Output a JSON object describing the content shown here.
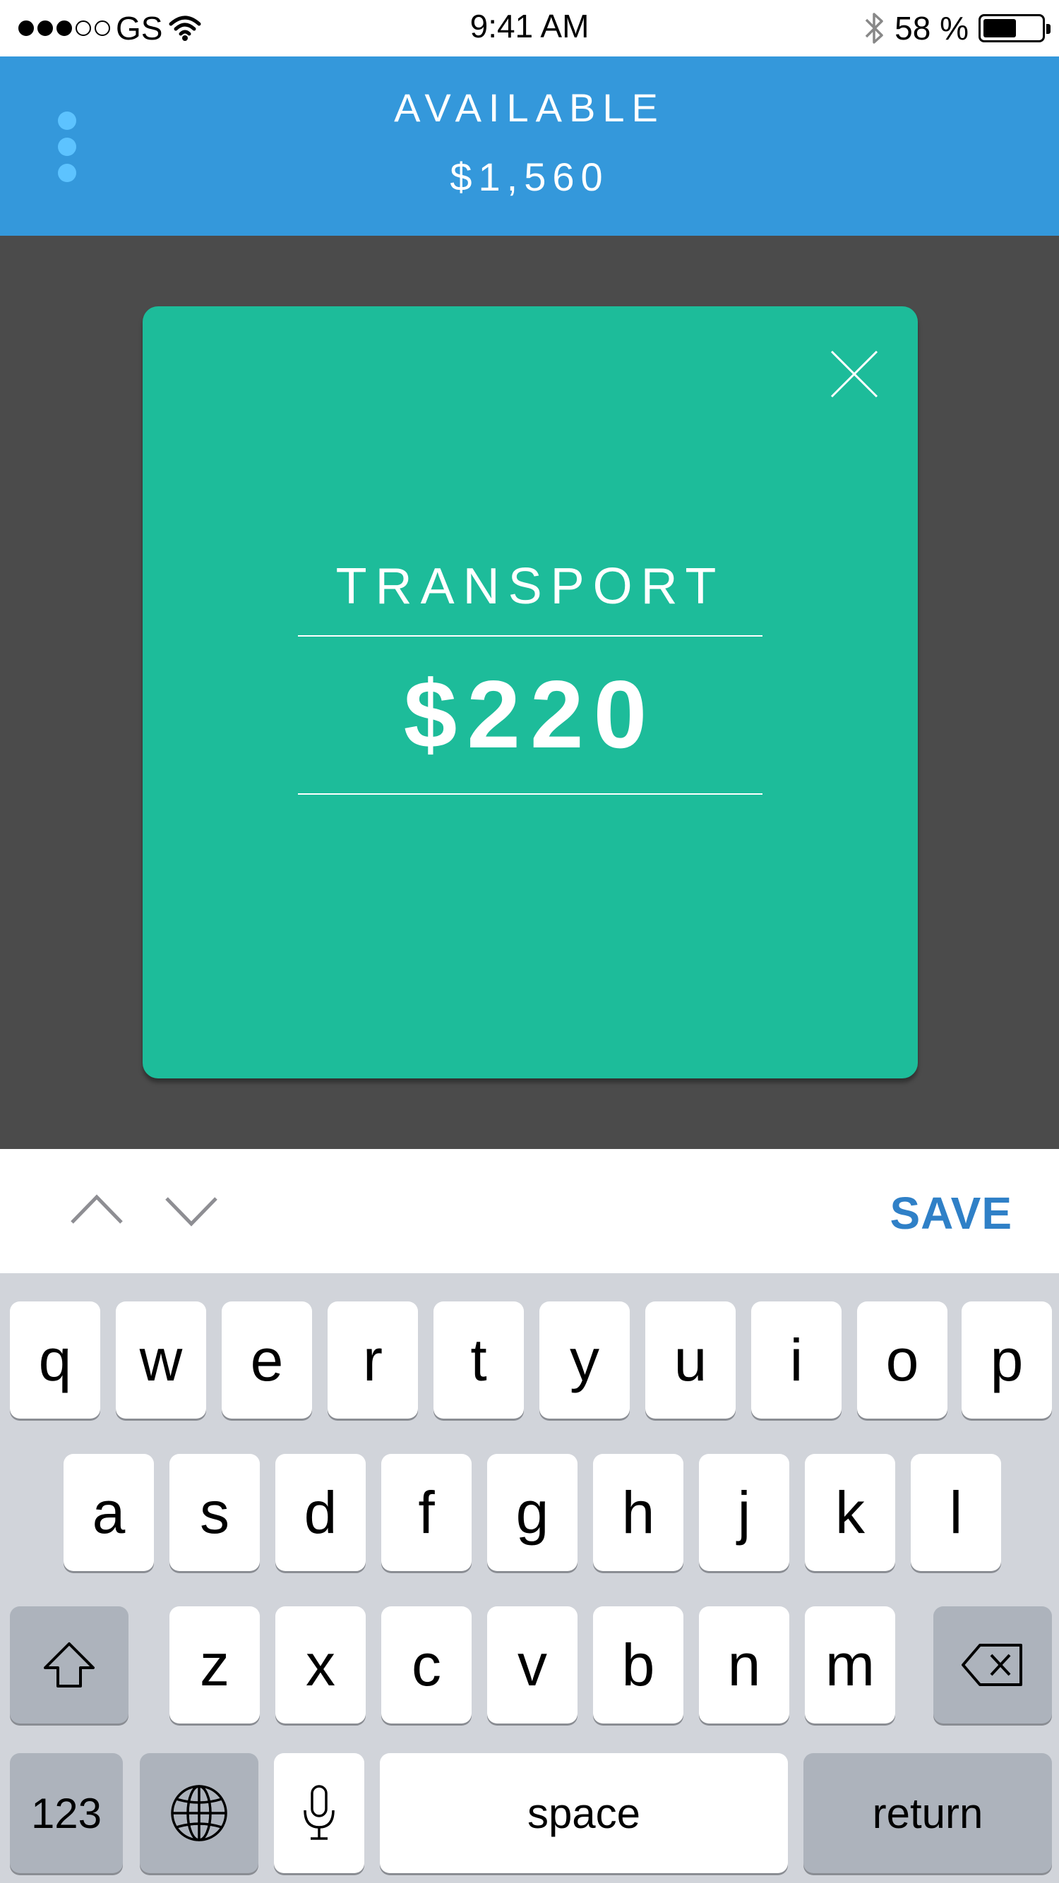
{
  "status_bar": {
    "carrier": "GS",
    "time": "9:41 AM",
    "battery": "58 %",
    "battery_level": 0.58,
    "signal_bars_filled": 3,
    "signal_bars_total": 5
  },
  "header": {
    "label": "AVAILABLE",
    "amount": "$1,560"
  },
  "card": {
    "title": "TRANSPORT",
    "amount": "$220"
  },
  "toolbar": {
    "save_label": "SAVE"
  },
  "keyboard": {
    "row1": [
      "q",
      "w",
      "e",
      "r",
      "t",
      "y",
      "u",
      "i",
      "o",
      "p"
    ],
    "row2": [
      "a",
      "s",
      "d",
      "f",
      "g",
      "h",
      "j",
      "k",
      "l"
    ],
    "row3": [
      "z",
      "x",
      "c",
      "v",
      "b",
      "n",
      "m"
    ],
    "numbers_label": "123",
    "space_label": "space",
    "return_label": "return"
  },
  "colors": {
    "header": "#3498db",
    "card": "#1dbc9a",
    "overlay": "#4b4b4b",
    "save": "#2f80c7",
    "keyboard": "#d1d4da"
  }
}
